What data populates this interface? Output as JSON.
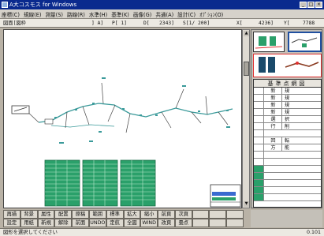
{
  "window": {
    "title": "A大コスモス for Windows"
  },
  "menu": [
    "座標(C)",
    "規線(E)",
    "測量(S)",
    "路線(R)",
    "水準(H)",
    "基準(K)",
    "画像(G)",
    "共通(A)",
    "設計(C)",
    "ｵﾌﾟｼｮﾝ(O)"
  ],
  "status": {
    "mode": "図面[図枠",
    "a_label": "] A]",
    "p_label": "P[ 1]",
    "d_label": "D[",
    "d_value": "2343]",
    "s_label": "S[1/  200]",
    "x_label": "X[",
    "x_value": "4236]",
    "y_label": "Y[",
    "y_value": "7788"
  },
  "grid": {
    "header": "基準点網図",
    "rows": [
      {
        "b": "新",
        "c": "規"
      },
      {
        "b": "新",
        "c": "規"
      },
      {
        "b": "新",
        "c": "規"
      },
      {
        "b": "新",
        "c": "規"
      },
      {
        "b": "選",
        "c": "択"
      },
      {
        "b": "行",
        "c": "削"
      },
      {
        "b": "",
        "c": ""
      },
      {
        "b": "回",
        "c": "転"
      },
      {
        "b": "方",
        "c": "能"
      },
      {
        "b": "",
        "c": ""
      },
      {
        "b": "",
        "c": ""
      },
      {
        "b": "",
        "c": ""
      },
      {
        "b": "",
        "c": ""
      },
      {
        "b": "",
        "c": ""
      },
      {
        "b": "",
        "c": ""
      },
      {
        "b": "",
        "c": ""
      }
    ]
  },
  "toolbar": [
    "再描",
    "背景",
    "属性",
    "配置",
    "原稿",
    "範囲",
    "標準",
    "拡大",
    "縮小",
    "前頁",
    "次頁",
    "",
    "",
    "",
    "設定",
    "用紙",
    "新規",
    "解除",
    "前面",
    "UNDO",
    "定航",
    "全図",
    "WIND",
    "改頁",
    "畳点",
    "",
    "",
    ""
  ],
  "bottom": {
    "message": "図形を選択してください",
    "zoom": "0.101"
  },
  "chart_colors": {
    "line": "#3a9a9a",
    "table": "#2aa06a"
  }
}
